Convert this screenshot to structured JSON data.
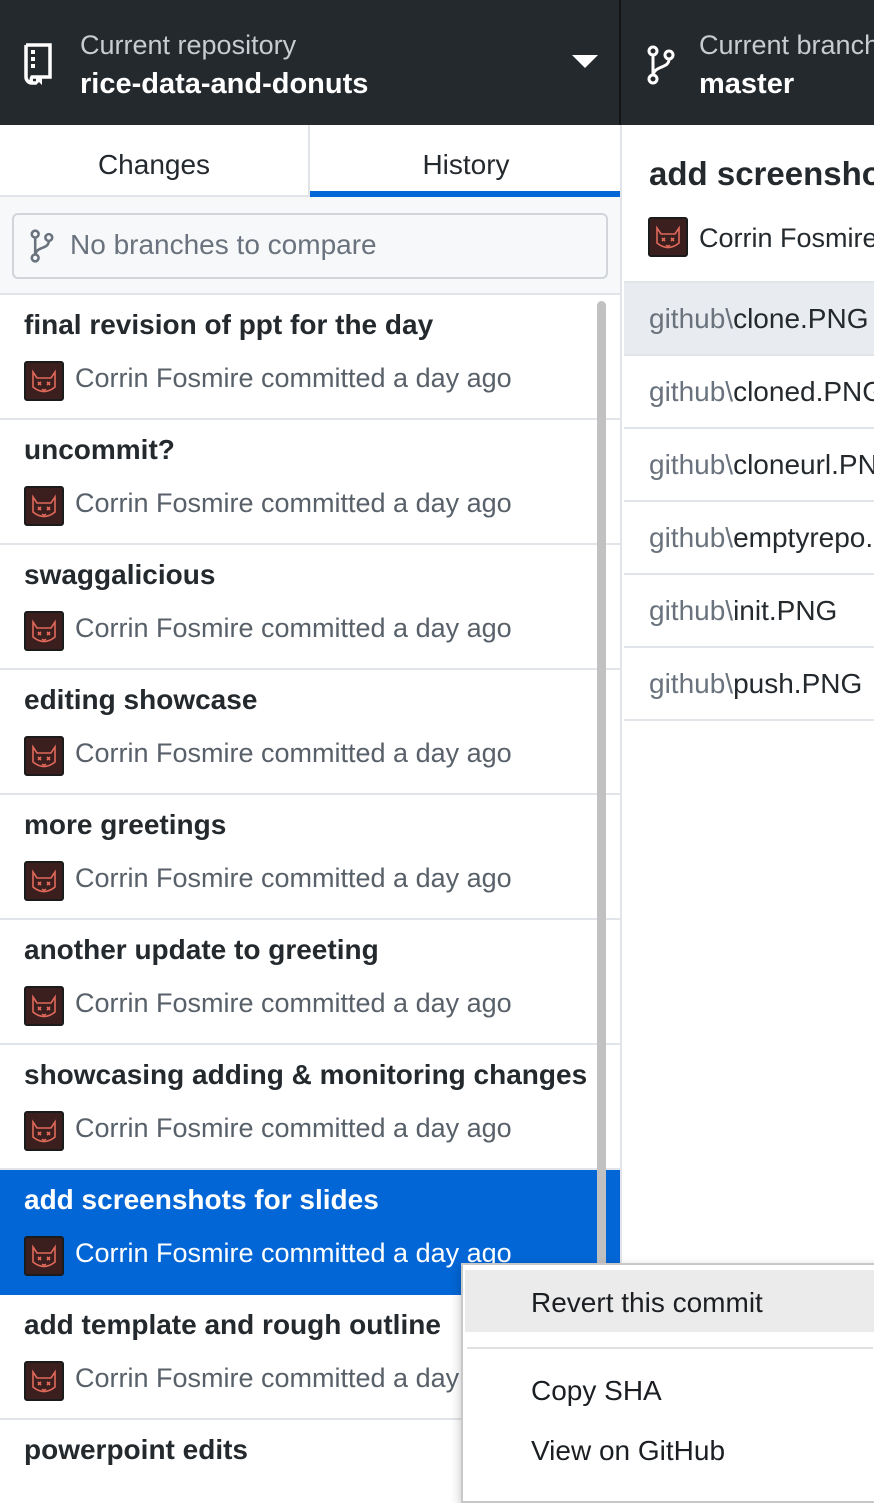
{
  "topbar": {
    "repository_label": "Current repository",
    "repository_name": "rice-data-and-donuts",
    "branch_label": "Current branch",
    "branch_name": "master"
  },
  "tabs": {
    "changes": "Changes",
    "history": "History"
  },
  "compare": {
    "placeholder": "No branches to compare"
  },
  "commits": [
    {
      "title": "final revision of ppt for the day",
      "meta": "Corrin Fosmire committed a day ago"
    },
    {
      "title": "uncommit?",
      "meta": "Corrin Fosmire committed a day ago"
    },
    {
      "title": "swaggalicious",
      "meta": "Corrin Fosmire committed a day ago"
    },
    {
      "title": "editing showcase",
      "meta": "Corrin Fosmire committed a day ago"
    },
    {
      "title": "more greetings",
      "meta": "Corrin Fosmire committed a day ago"
    },
    {
      "title": "another update to greeting",
      "meta": "Corrin Fosmire committed a day ago"
    },
    {
      "title": "showcasing adding & monitoring changes",
      "meta": "Corrin Fosmire committed a day ago"
    },
    {
      "title": "add screenshots for slides",
      "meta": "Corrin Fosmire committed a day ago"
    },
    {
      "title": "add template and rough outline",
      "meta": "Corrin Fosmire committed a day ago"
    },
    {
      "title": "powerpoint edits",
      "meta": ""
    }
  ],
  "selected_commit_index": 7,
  "detail": {
    "title": "add screenshots for slides",
    "author": "Corrin Fosmire",
    "files": [
      {
        "dir": "github\\",
        "name": "clone.PNG"
      },
      {
        "dir": "github\\",
        "name": "cloned.PNG"
      },
      {
        "dir": "github\\",
        "name": "cloneurl.PNG"
      },
      {
        "dir": "github\\",
        "name": "emptyrepo.PNG"
      },
      {
        "dir": "github\\",
        "name": "init.PNG"
      },
      {
        "dir": "github\\",
        "name": "push.PNG"
      }
    ]
  },
  "context_menu": {
    "revert": "Revert this commit",
    "copy_sha": "Copy SHA",
    "view_on_github": "View on GitHub"
  },
  "colors": {
    "topbar_bg": "#24292e",
    "accent_blue": "#0366d6",
    "border": "#e1e4e8",
    "muted_text": "#586069"
  },
  "icons": {
    "repository": "repo-book-icon",
    "branch": "git-branch-icon",
    "dropdown": "caret-down-icon",
    "compare": "git-branch-icon",
    "avatar": "cat-avatar-icon"
  }
}
